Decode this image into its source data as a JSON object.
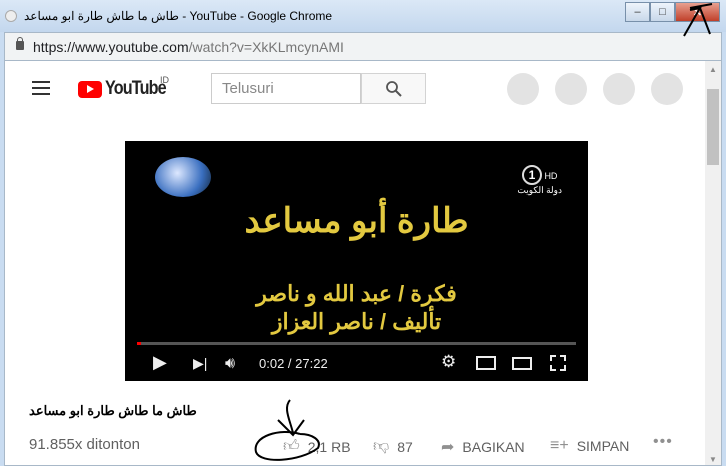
{
  "window": {
    "title": "طاش ما طاش طارة ابو مساعد - YouTube - Google Chrome",
    "minimize": "–",
    "maximize": "□",
    "close": "✕"
  },
  "address": {
    "url_host": "https://www.youtube.com",
    "url_path": "/watch?v=XkKLmcynAMI"
  },
  "header": {
    "logo": "YouTube",
    "country": "ID",
    "search_placeholder": "Telusuri"
  },
  "video": {
    "card_title": "طارة أبو مساعد",
    "card_line1": "فكرة / عبد الله و ناصر",
    "card_line2": "تأليف / ناصر العزاز",
    "channel_badge": "1",
    "channel_hd": "HD",
    "channel_name": "دولة الكويت",
    "current_time": "0:02",
    "duration": "27:22",
    "time_display": "0:02 / 27:22",
    "progress_fraction": 0.0012
  },
  "info": {
    "title": "طاش ما طاش طارة ابو مساعد",
    "views": "91.855x ditonton",
    "likes": "2,1 RB",
    "dislikes": "87",
    "share": "BAGIKAN",
    "save": "SIMPAN",
    "more": "•••"
  },
  "colors": {
    "brand": "#ff0000",
    "card_text": "#e3c940"
  }
}
